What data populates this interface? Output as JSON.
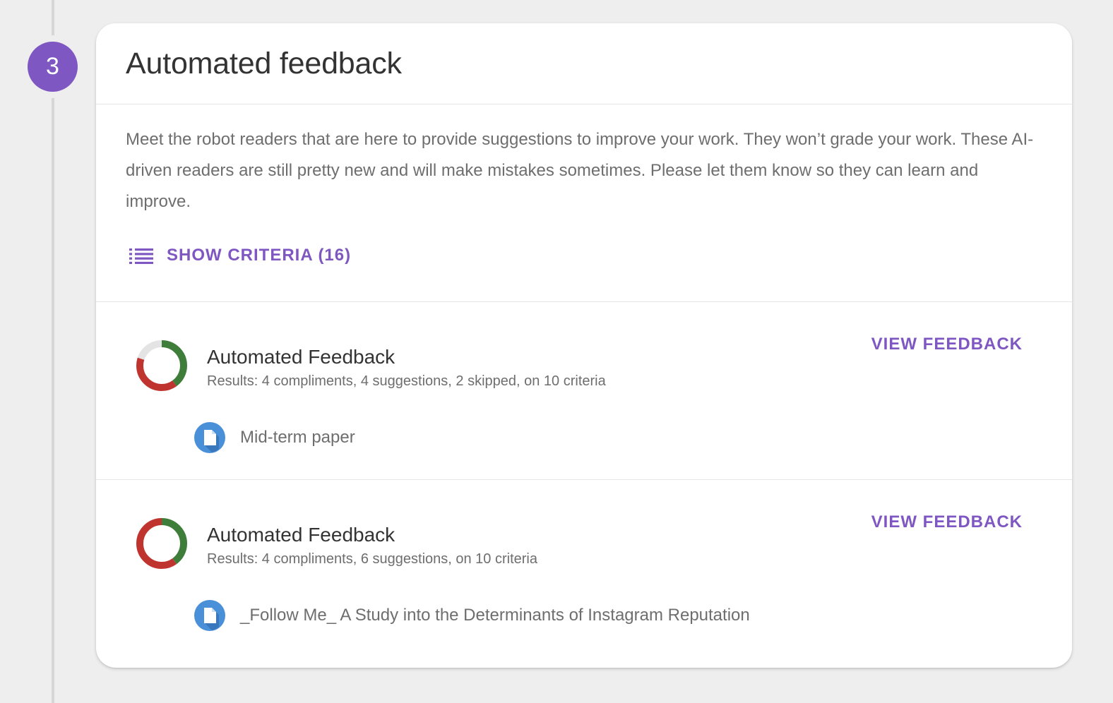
{
  "step": {
    "number": "3"
  },
  "card": {
    "title": "Automated feedback",
    "description": "Meet the robot readers that are here to provide suggestions to improve your work. They won’t grade your work. These AI-driven readers are still pretty new and will make mistakes sometimes. Please let them know so they can learn and improve.",
    "show_criteria_label": "SHOW CRITERIA (16)"
  },
  "feedback_items": [
    {
      "title": "Automated Feedback",
      "results": "Results: 4 compliments, 4 suggestions, 2 skipped, on 10 criteria",
      "view_label": "VIEW FEEDBACK",
      "document": "Mid-term paper",
      "donut": {
        "compliments": 4,
        "suggestions": 4,
        "skipped": 2
      }
    },
    {
      "title": "Automated Feedback",
      "results": "Results: 4 compliments, 6 suggestions, on 10 criteria",
      "view_label": "VIEW FEEDBACK",
      "document": "_Follow Me_ A Study into the Determinants of Instagram Reputation",
      "donut": {
        "compliments": 4,
        "suggestions": 6,
        "skipped": 0
      }
    }
  ],
  "colors": {
    "accent": "#7e57c2",
    "compliment": "#3f7d3a",
    "suggestion": "#c0342f",
    "skipped": "#e4e4e4",
    "doc_icon": "#4a90d9"
  },
  "icons": {
    "criteria": "list-icon",
    "document": "document-icon"
  }
}
